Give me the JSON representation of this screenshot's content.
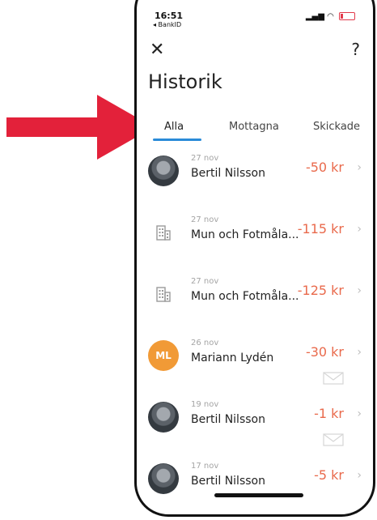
{
  "status": {
    "time": "16:51",
    "back_app": "◂ BankID"
  },
  "header": {
    "close_icon": "close-icon",
    "help_label": "?"
  },
  "title": "Historik",
  "tabs": [
    {
      "label": "Alla",
      "active": true
    },
    {
      "label": "Mottagna",
      "active": false
    },
    {
      "label": "Skickade",
      "active": false
    }
  ],
  "transactions": [
    {
      "date": "27 nov",
      "name": "Bertil Nilsson",
      "amount": "-50 kr",
      "avatar": "photo",
      "message_icon": false
    },
    {
      "date": "27 nov",
      "name": "Mun och Fotmåla...",
      "amount": "-115 kr",
      "avatar": "building-icon",
      "message_icon": false
    },
    {
      "date": "27 nov",
      "name": "Mun och Fotmåla...",
      "amount": "-125 kr",
      "avatar": "building-icon",
      "message_icon": false
    },
    {
      "date": "26 nov",
      "name": "Mariann Lydén",
      "amount": "-30 kr",
      "avatar": "ML",
      "message_icon": true
    },
    {
      "date": "19 nov",
      "name": "Bertil Nilsson",
      "amount": "-1 kr",
      "avatar": "photo",
      "message_icon": true
    },
    {
      "date": "17 nov",
      "name": "Bertil Nilsson",
      "amount": "-5 kr",
      "avatar": "photo",
      "message_icon": false
    }
  ],
  "colors": {
    "accent_tab": "#2a8bd8",
    "amount": "#e96a4c",
    "arrow": "#e3213a",
    "initials_bg": "#f19a36"
  }
}
